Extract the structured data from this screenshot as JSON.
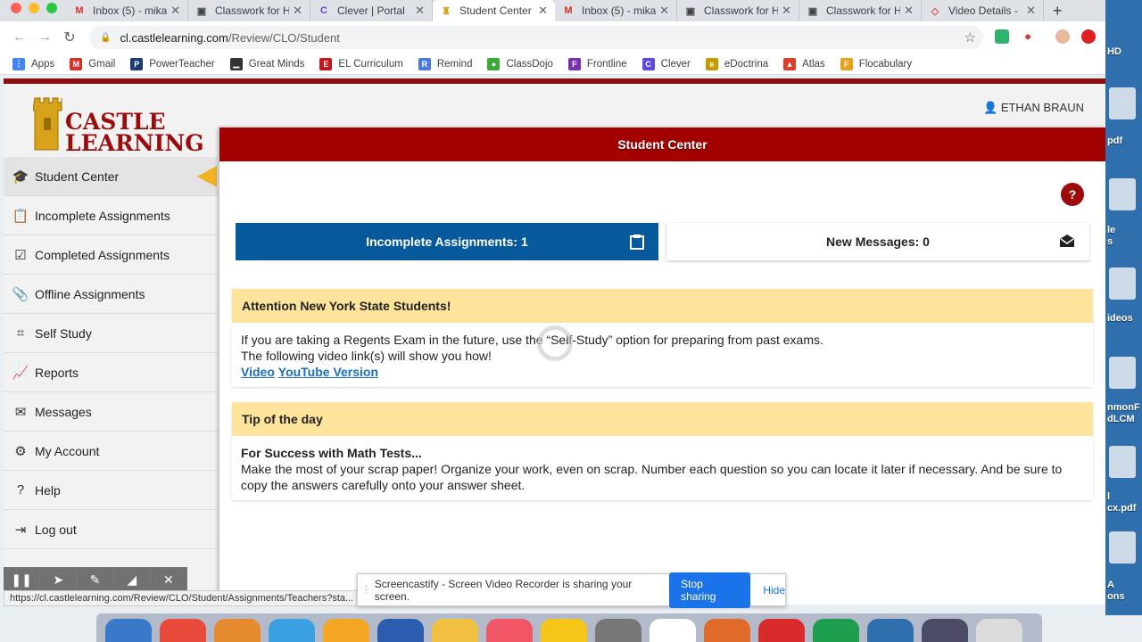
{
  "browser": {
    "tabs": [
      {
        "title": "Inbox (5) - mika",
        "favicon": "gmail-icon",
        "color": "#d93025",
        "glyph": "M",
        "active": false
      },
      {
        "title": "Classwork for H",
        "favicon": "classroom-icon",
        "color": "#444",
        "glyph": "▣",
        "active": false
      },
      {
        "title": "Clever | Portal",
        "favicon": "clever-icon",
        "color": "#5b4ae6",
        "glyph": "C",
        "active": false
      },
      {
        "title": "Student Center",
        "favicon": "castle-icon",
        "color": "#d8a21a",
        "glyph": "♜",
        "active": true
      },
      {
        "title": "Inbox (5) - mika",
        "favicon": "gmail-icon",
        "color": "#d93025",
        "glyph": "M",
        "active": false
      },
      {
        "title": "Classwork for H",
        "favicon": "classroom-icon",
        "color": "#444",
        "glyph": "▣",
        "active": false
      },
      {
        "title": "Classwork for H",
        "favicon": "classroom-icon",
        "color": "#444",
        "glyph": "▣",
        "active": false
      },
      {
        "title": "Video Details -",
        "favicon": "video-icon",
        "color": "#e0454a",
        "glyph": "◇",
        "active": false
      }
    ],
    "url": "cl.castlelearning.com/Review/CLO/Student",
    "url_domain": "cl.castlelearning.com",
    "url_path": "/Review/CLO/Student",
    "bookmarks": [
      {
        "label": "Apps",
        "icon": "apps-grid-icon",
        "color": "#4285f4",
        "glyph": "⋮"
      },
      {
        "label": "Gmail",
        "icon": "gmail-icon",
        "color": "#d93025",
        "glyph": "M"
      },
      {
        "label": "PowerTeacher",
        "icon": "powerteacher-icon",
        "color": "#1c3c78",
        "glyph": "P"
      },
      {
        "label": "Great Minds",
        "icon": "greatminds-icon",
        "color": "#333",
        "glyph": "▁"
      },
      {
        "label": "EL Curriculum",
        "icon": "el-icon",
        "color": "#c4161c",
        "glyph": "E"
      },
      {
        "label": "Remind",
        "icon": "remind-icon",
        "color": "#4a7be3",
        "glyph": "R"
      },
      {
        "label": "ClassDojo",
        "icon": "classdojo-icon",
        "color": "#3aa935",
        "glyph": "●"
      },
      {
        "label": "Frontline",
        "icon": "frontline-icon",
        "color": "#7b2fb3",
        "glyph": "F"
      },
      {
        "label": "Clever",
        "icon": "clever-icon",
        "color": "#5b4ae6",
        "glyph": "C"
      },
      {
        "label": "eDoctrina",
        "icon": "edoctrina-icon",
        "color": "#c79a00",
        "glyph": "e"
      },
      {
        "label": "Atlas",
        "icon": "atlas-icon",
        "color": "#e03c2e",
        "glyph": "▲"
      },
      {
        "label": "Flocabulary",
        "icon": "flocabulary-icon",
        "color": "#e8a21a",
        "glyph": "F"
      }
    ]
  },
  "header": {
    "logo_line1": "CASTLE",
    "logo_line2": "LEARNING",
    "user_name": "ETHAN BRAUN"
  },
  "sidebar": {
    "items": [
      {
        "label": "Student Center",
        "icon": "graduation-cap-icon",
        "glyph": "🎓",
        "active": true
      },
      {
        "label": "Incomplete Assignments",
        "icon": "clipboard-icon",
        "glyph": "📋",
        "active": false
      },
      {
        "label": "Completed Assignments",
        "icon": "checkbox-icon",
        "glyph": "☑",
        "active": false
      },
      {
        "label": "Offline Assignments",
        "icon": "paperclip-icon",
        "glyph": "📎",
        "active": false
      },
      {
        "label": "Self Study",
        "icon": "easel-icon",
        "glyph": "⌗",
        "active": false
      },
      {
        "label": "Reports",
        "icon": "line-chart-icon",
        "glyph": "📈",
        "active": false
      },
      {
        "label": "Messages",
        "icon": "envelope-icon",
        "glyph": "✉",
        "active": false
      },
      {
        "label": "My Account",
        "icon": "gear-icon",
        "glyph": "⚙",
        "active": false
      },
      {
        "label": "Help",
        "icon": "question-icon",
        "glyph": "?",
        "active": false
      },
      {
        "label": "Log out",
        "icon": "logout-icon",
        "glyph": "⇥",
        "active": false
      }
    ]
  },
  "main": {
    "title": "Student Center",
    "help_label": "?",
    "incomplete_card": "Incomplete Assignments: 1",
    "messages_card": "New Messages: 0",
    "attention": {
      "heading": "Attention New York State Students!",
      "line1": "If you are taking a Regents Exam in the future, use the “Self-Study” option for preparing from past exams.",
      "line2": "The following video link(s) will show you how!",
      "link1": "Video",
      "link2": "YouTube Version"
    },
    "tip": {
      "heading": "Tip of the day",
      "title": "For Success with Math Tests...",
      "body": "Make the most of your scrap paper! Organize your work, even on scrap. Number each question so you can locate it later if necessary. And be sure to copy the answers carefully onto your answer sheet."
    }
  },
  "status_url": "https://cl.castlelearning.com/Review/CLO/Student/Assignments/Teachers?sta...",
  "share_bar": {
    "text": "Screencastify - Screen Video Recorder is sharing your screen.",
    "stop": "Stop sharing",
    "hide": "Hide"
  },
  "desktop_labels": [
    "HD",
    "pdf",
    "le",
    "s",
    "ideos",
    "nmonF",
    "dLCM",
    "l",
    "cx.pdf",
    "A",
    "ons"
  ]
}
